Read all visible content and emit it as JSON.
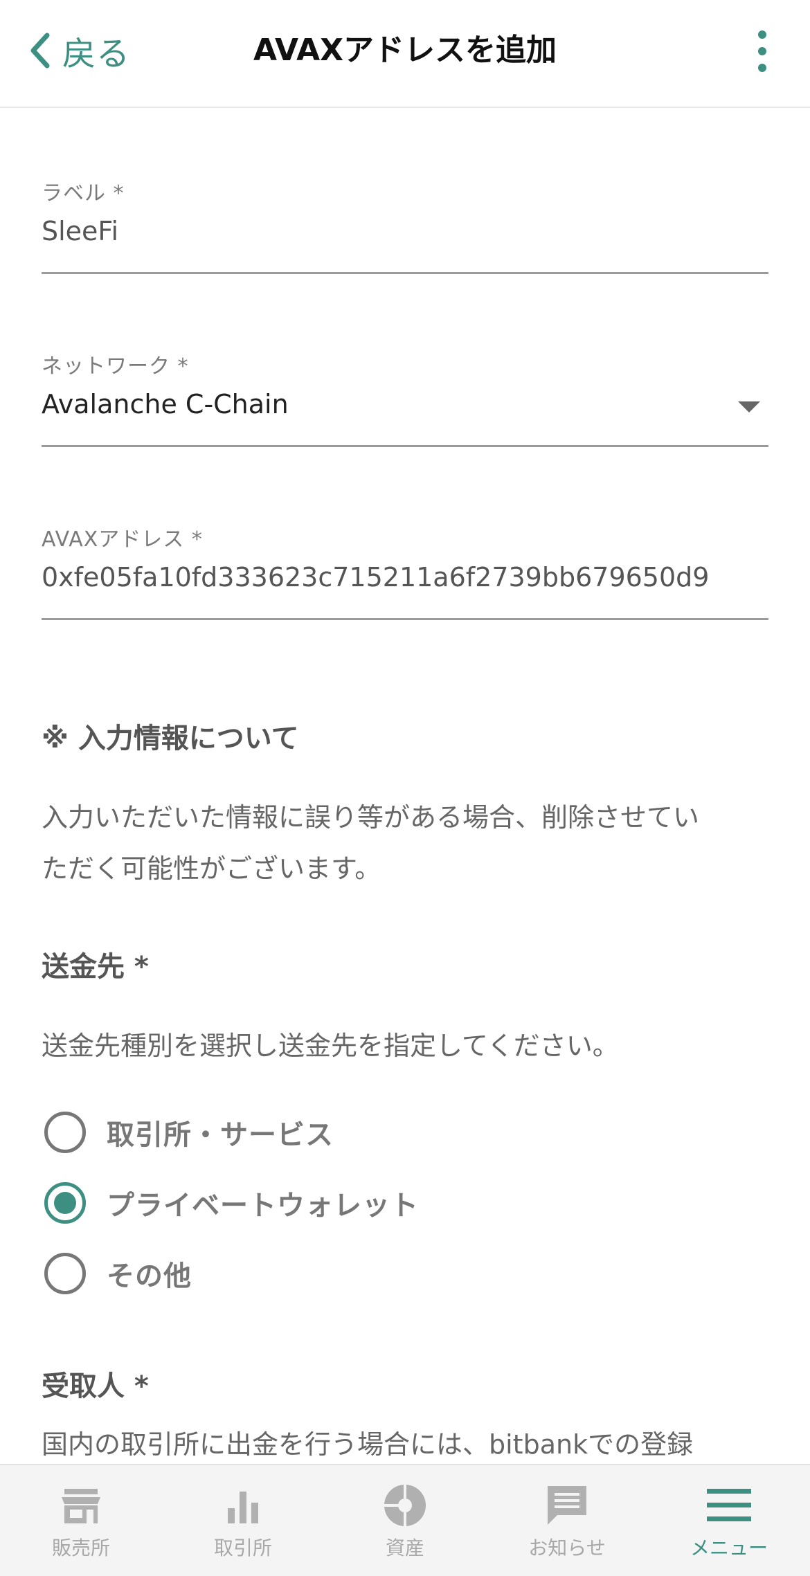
{
  "header": {
    "back_label": "戻る",
    "title": "AVAXアドレスを追加"
  },
  "form": {
    "label_field": {
      "label": "ラベル *",
      "value": "SleeFi"
    },
    "network_field": {
      "label": "ネットワーク *",
      "value": "Avalanche C-Chain"
    },
    "address_field": {
      "label": "AVAXアドレス *",
      "value": "0xfe05fa10fd333623c715211a6f2739bb679650d9"
    }
  },
  "notice": {
    "heading": "※ 入力情報について",
    "line1": "入力いただいた情報に誤り等がある場合、削除させてい",
    "line2": "ただく可能性がございます。"
  },
  "destination": {
    "heading": "送金先 *",
    "instruction": "送金先種別を選択し送金先を指定してください。",
    "options": [
      {
        "label": "取引所・サービス",
        "selected": false
      },
      {
        "label": "プライベートウォレット",
        "selected": true
      },
      {
        "label": "その他",
        "selected": false
      }
    ]
  },
  "recipient": {
    "heading": "受取人 *",
    "text": "国内の取引所に出金を行う場合には、bitbankでの登録"
  },
  "bottom_nav": {
    "items": [
      {
        "label": "販売所",
        "icon": "store-icon",
        "active": false
      },
      {
        "label": "取引所",
        "icon": "bar-chart-icon",
        "active": false
      },
      {
        "label": "資産",
        "icon": "pie-chart-icon",
        "active": false
      },
      {
        "label": "お知らせ",
        "icon": "message-icon",
        "active": false
      },
      {
        "label": "メニュー",
        "icon": "menu-icon",
        "active": true
      }
    ]
  },
  "colors": {
    "accent": "#3d8f82",
    "inactive": "#a8a8a8"
  }
}
